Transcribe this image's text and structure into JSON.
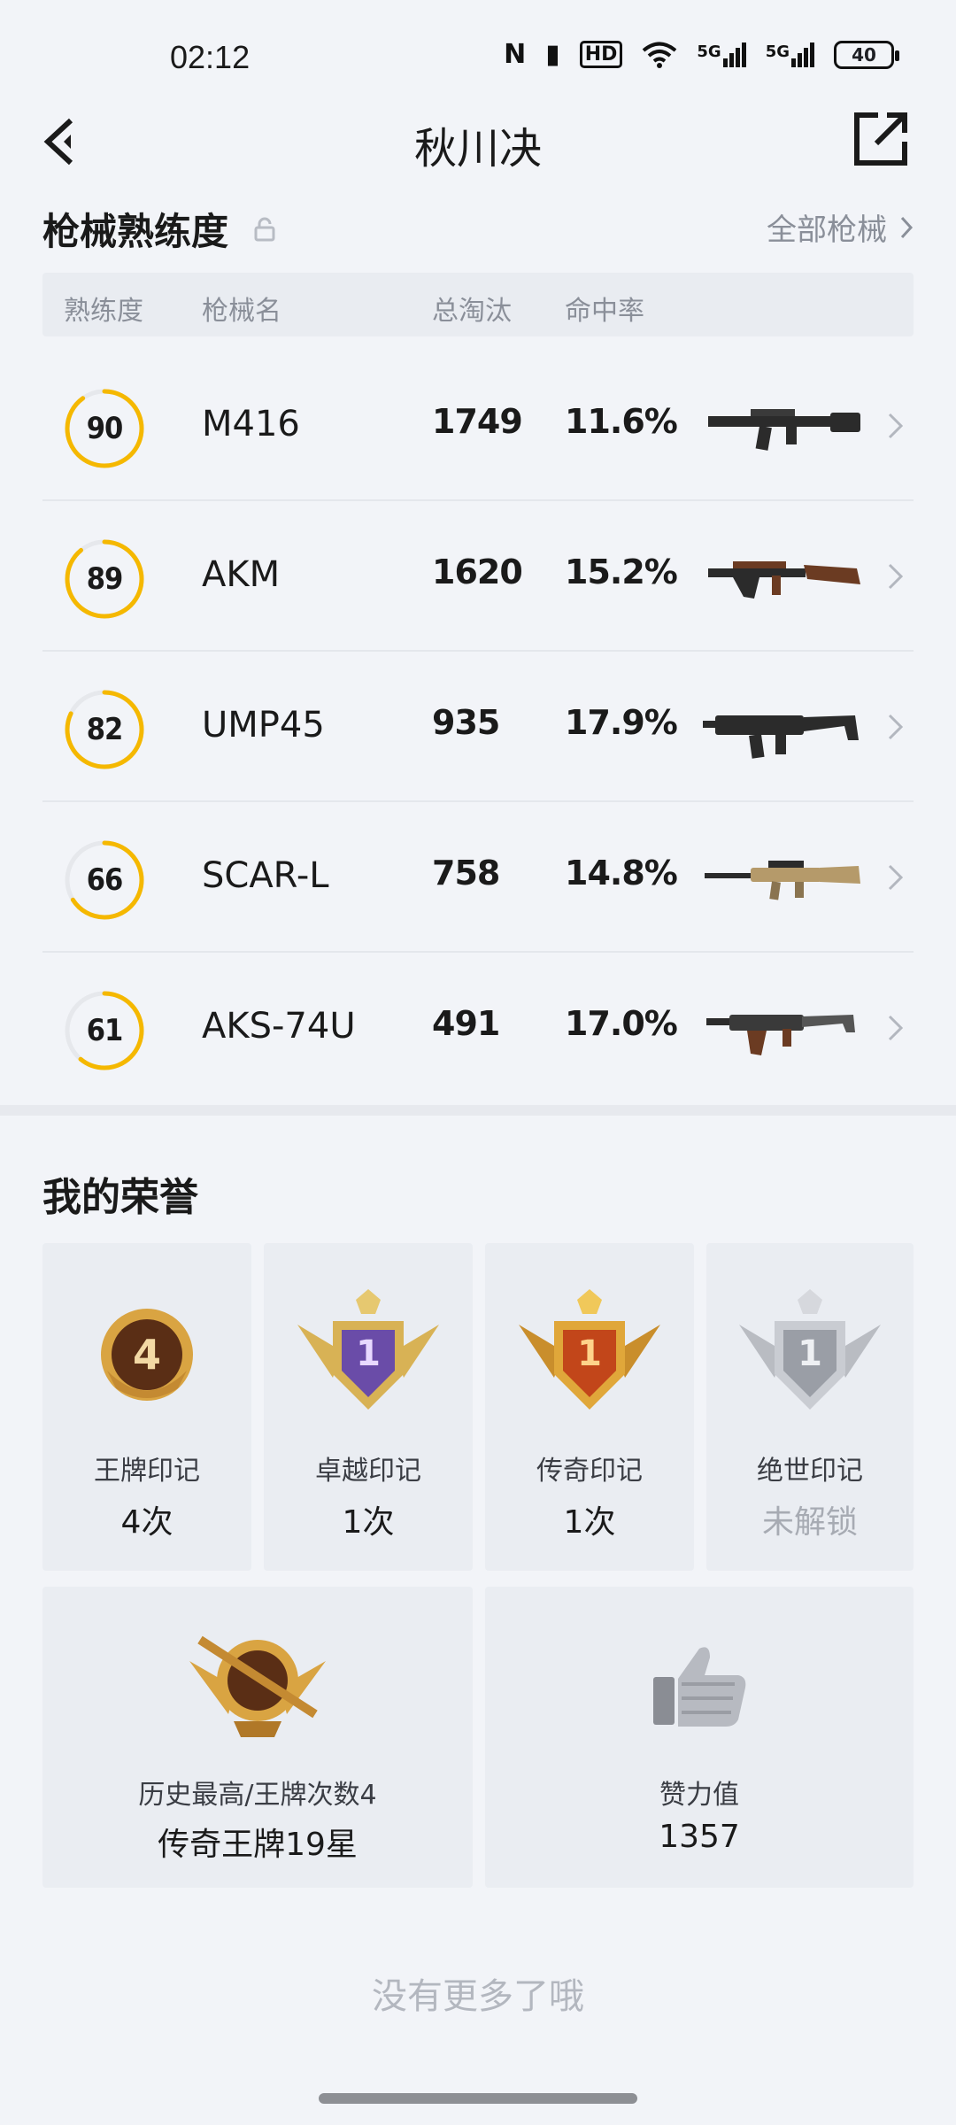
{
  "status": {
    "time": "02:12",
    "nfc": "N",
    "network1": "5G",
    "network2": "5G",
    "battery": "40"
  },
  "nav": {
    "title": "秋川决"
  },
  "mastery": {
    "title": "枪械熟练度",
    "all_guns": "全部枪械",
    "headers": {
      "level": "熟练度",
      "name": "枪械名",
      "kills": "总淘汰",
      "rate": "命中率"
    },
    "rows": [
      {
        "level": "90",
        "level_pct": 90,
        "name": "M416",
        "kills": "1749",
        "rate": "11.6%",
        "gun_icon": "rifle-icon"
      },
      {
        "level": "89",
        "level_pct": 89,
        "name": "AKM",
        "kills": "1620",
        "rate": "15.2%",
        "gun_icon": "rifle-icon"
      },
      {
        "level": "82",
        "level_pct": 82,
        "name": "UMP45",
        "kills": "935",
        "rate": "17.9%",
        "gun_icon": "smg-icon"
      },
      {
        "level": "66",
        "level_pct": 66,
        "name": "SCAR-L",
        "kills": "758",
        "rate": "14.8%",
        "gun_icon": "rifle-icon"
      },
      {
        "level": "61",
        "level_pct": 61,
        "name": "AKS-74U",
        "kills": "491",
        "rate": "17.0%",
        "gun_icon": "rifle-icon"
      }
    ]
  },
  "honors": {
    "title": "我的荣誉",
    "marks": [
      {
        "label": "王牌印记",
        "value": "4次",
        "emblem_text": "4",
        "icon": "ace-emblem-icon"
      },
      {
        "label": "卓越印记",
        "value": "1次",
        "emblem_text": "1",
        "icon": "excellence-emblem-icon"
      },
      {
        "label": "传奇印记",
        "value": "1次",
        "emblem_text": "1",
        "icon": "legend-emblem-icon"
      },
      {
        "label": "绝世印记",
        "value": "未解锁",
        "emblem_text": "1",
        "icon": "peerless-emblem-icon"
      }
    ],
    "highest": {
      "label": "历史最高/王牌次数4",
      "value": "传奇王牌19星",
      "icon": "highest-rank-emblem-icon"
    },
    "likes": {
      "label": "赞力值",
      "value": "1357",
      "icon": "thumbs-up-icon"
    }
  },
  "footer": {
    "no_more": "没有更多了哦"
  },
  "colors": {
    "accent": "#f5b800",
    "ring_track": "#e6e8ec",
    "background": "#f2f4f8"
  }
}
